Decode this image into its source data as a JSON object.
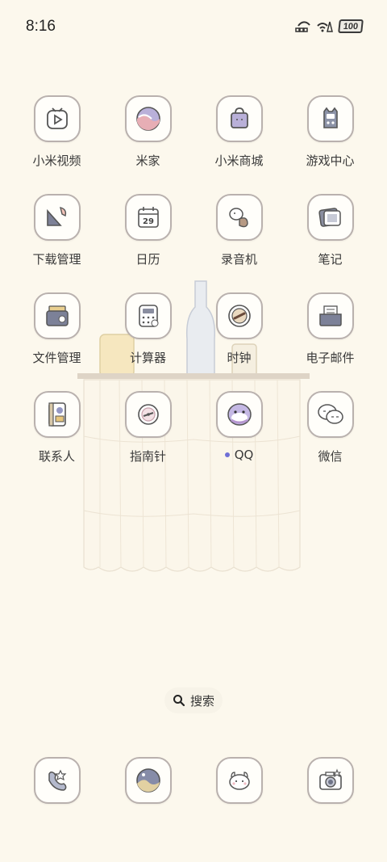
{
  "status": {
    "time": "8:16",
    "battery": "100"
  },
  "apps": [
    [
      {
        "label": "小米视频",
        "icon": "video-play-icon"
      },
      {
        "label": "米家",
        "icon": "mijia-icon"
      },
      {
        "label": "小米商城",
        "icon": "shopping-bag-icon"
      },
      {
        "label": "游戏中心",
        "icon": "game-controller-icon"
      }
    ],
    [
      {
        "label": "下载管理",
        "icon": "download-icon"
      },
      {
        "label": "日历",
        "icon": "calendar-icon",
        "calendar_day": "29"
      },
      {
        "label": "录音机",
        "icon": "recorder-icon"
      },
      {
        "label": "笔记",
        "icon": "notes-icon"
      }
    ],
    [
      {
        "label": "文件管理",
        "icon": "folder-icon"
      },
      {
        "label": "计算器",
        "icon": "calculator-icon"
      },
      {
        "label": "时钟",
        "icon": "clock-icon"
      },
      {
        "label": "电子邮件",
        "icon": "mail-icon"
      }
    ],
    [
      {
        "label": "联系人",
        "icon": "contacts-icon"
      },
      {
        "label": "指南针",
        "icon": "compass-icon"
      },
      {
        "label": "QQ",
        "icon": "qq-penguin-icon",
        "notification_dot": true
      },
      {
        "label": "微信",
        "icon": "wechat-icon"
      }
    ]
  ],
  "search": {
    "label": "搜索"
  },
  "dock": [
    {
      "icon": "phone-icon"
    },
    {
      "icon": "browser-icon"
    },
    {
      "icon": "messages-icon"
    },
    {
      "icon": "camera-icon"
    }
  ],
  "colors": {
    "background": "#fcf8ed",
    "icon_border": "#b9b1ae",
    "notification_dot": "#6f6fd6"
  }
}
